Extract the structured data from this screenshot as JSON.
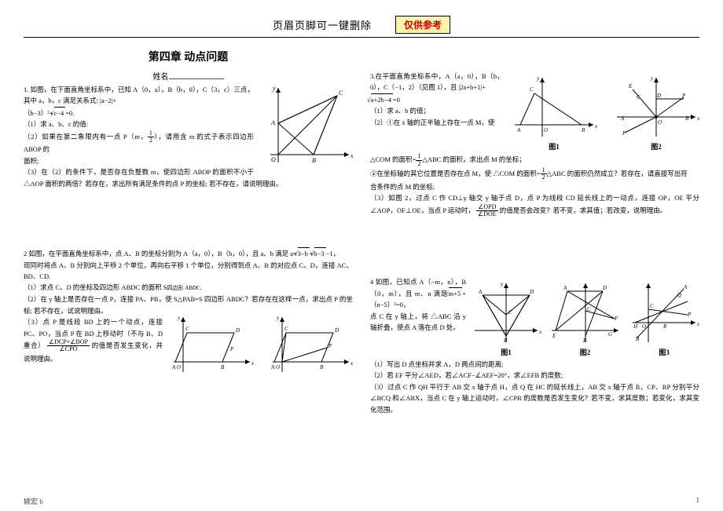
{
  "header": {
    "text": "页眉页脚可一键删除",
    "ref": "仅供参考"
  },
  "chapter_title": "第四章    动点问题",
  "name_label": "姓名",
  "q1": {
    "intro": "1. 如图，在下面直角坐标系中，已知 A（0，a），B（b，0），C（3，c）三点，其中 a，b，c 满足关系式: |a−2|+",
    "eq": "（b−3）²+",
    "eq2": "=0.",
    "sqrt1": "c−4",
    "p1": "（1）求 a、b、c 的值:",
    "p2a": "（2）如果在第二象限内有一点 P（m，",
    "p2b": "），请用含 m 的式子表示四边形 ABOP 的",
    "p2c": "面积;",
    "p3": "（3）在（2）的条件下，是否存在负整数 m，使四边形 ABOP 的面积不小于 △AOP 面积的两倍？若存在，求出所有满足条件的点 P 的坐标; 若不存在，请说明理由。",
    "frac_half_n": "1",
    "frac_half_d": "2"
  },
  "q2": {
    "intro": "2 如图，在平面直角坐标系中，点 A、B 的坐标分别为 A（a，0），B（b，0），且 a、b 满足 a=",
    "sqrt_a": "3−b",
    "plus": "+",
    "sqrt_b": "b−3",
    "tail": "−1，",
    "l2": "现同时将点 A、B 分别向上平移 2 个单位，再向右平移 1 个单位，分别得到点 A、B 的对应点 C、D，连接 AC、BD、CD.",
    "p1": "（1）求点 C、D 的坐标及四边形 ABDC 的面积 S",
    "p1sub": "四边形 ABDC",
    "p2": "（2）在 y 轴上是否存在一点 P，连接 PA、PB，使 S△PAB=S 四边形 ABDC？若存在在这样一点，求出点 P 的坐标; 若不存在，试说明理由。",
    "p3a": "（3）点 P 是线段 BD 上的一个动点，连接 PC、PO，当点 P 在 BD 上移动时（不与 B、D 重合）",
    "fnum": "∠DCP+∠BOP",
    "fden": "∠CPO",
    "p3b": "的值是否发生变化，并说明理由。"
  },
  "q3": {
    "intro": "3.在平面直角坐标系中，A（a，0），B（b，0），C（−1，2）（见图 1），且 |2a+b+1|+",
    "sqrt": "a+2b−4",
    "eq": "=0",
    "p1": "（1）求 a、b 的值；",
    "p2a": "（2）①在 x 轴的正半轴上存在一点 M，使",
    "p2b": "△COM 的面积=",
    "p2c": "△ABC 的面积，求出点 M 的坐标；",
    "p2d": "②在坐标轴的其它位置是否存在点 M，使 △COM 的面积=",
    "p2e": "△ABC 的面积仍然成立？若存在，请直接写出符",
    "p2f": "合条件的点 M 的坐标;",
    "p3": "（3）如图 2，过点 C 作 CD⊥y 轴交 y 轴于点 D，点 P 为线段 CD 延长线上的一动点，连接 OP，OE 平分∠AOP，OF⊥OE，当点 P 运动时，",
    "fnum": "∠OPD",
    "fden": "∠DOE",
    "p3b": "的值是否会改变？若不变，求其值；若改变，说明理由。",
    "half_n": "1",
    "half_d": "2"
  },
  "q4": {
    "intro": "4 如图，已知点 A（−m，n），B（0，m），且 m、n 满足",
    "sqrt": "m+5",
    "plus": "+（n−5）²=0，",
    "l2": "点 C 在 y 轴上，将 △ABC 沿 y 轴折叠，使点 A 落在点 D 处。",
    "p1": "（1）写出 D 点坐标并求 A，D 两点间的距离;",
    "p2": "（2）若 EF 平分∠AED，若∠ACF−∠AEF=20°，求∠EFB 的度数;",
    "p3": "（3）过点 C 作 QH 平行于 AB 交 x 轴于点 H，点 Q 在 HC 的延长线上，AB 交 x 轴于点 R，CP、RP 分别平分∠BCQ 和∠ARX，当点 C 在 y 轴上运动时，∠CPR 的度数是否发生变化？若不变，求其度数；若变化，求其变化范围。"
  },
  "fig_labels": {
    "f1": "图1",
    "f2": "图2",
    "f3": "图3"
  },
  "footer": {
    "left": "姚宏 b",
    "right": "1"
  }
}
